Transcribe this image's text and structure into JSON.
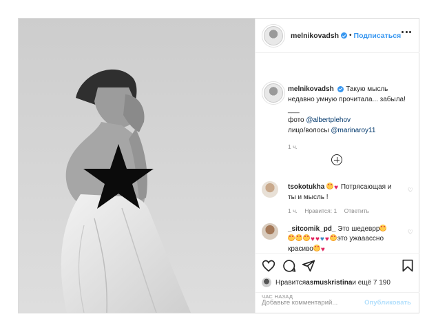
{
  "post": {
    "username": "melnikovadsh",
    "dot": "•",
    "follow_label": "Подписаться",
    "caption": {
      "username": "melnikovadsh",
      "line1": "Такую мысль недавно умную прочитала... забыла!",
      "line2": "___",
      "photo_prefix": "фото ",
      "photo_mention": "@albertplehov",
      "face_prefix": "лицо/волосы ",
      "face_mention": "@marinaroy11",
      "time": "1 ч."
    },
    "comments": [
      {
        "username": "tsokotukha",
        "text_after_emoji": " Потрясающая и ты и мысль !",
        "time": "1 ч.",
        "likes": "Нравится: 1",
        "reply": "Ответить"
      },
      {
        "username": "_sitcomik_pd_",
        "text": "Это шедеврр",
        "text2": "это ужааассно красиво"
      }
    ],
    "likes": {
      "prefix": "Нравится ",
      "user": "asmuskristina",
      "middle": " и ещё ",
      "count": "7 190"
    },
    "time_ago": "ЧАС НАЗАД",
    "comment_placeholder": "Добавьте комментарий...",
    "publish_label": "Опубликовать"
  },
  "icons": {
    "verified": "verified-badge-icon",
    "more": "more-options-icon",
    "add_comments": "plus-circle-icon",
    "heart": "heart-icon",
    "comment": "comment-icon",
    "share": "share-icon",
    "save": "bookmark-icon"
  },
  "colors": {
    "accent": "#3897f0",
    "publish_disabled": "#b2dffc",
    "muted": "#8e8e8e"
  }
}
